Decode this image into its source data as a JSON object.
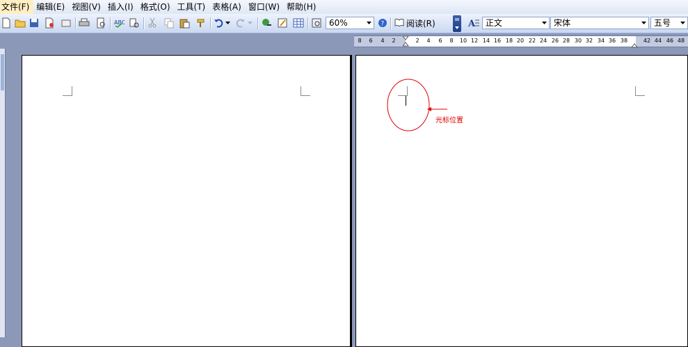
{
  "menu": {
    "items": [
      {
        "label": "文件(F)"
      },
      {
        "label": "编辑(E)"
      },
      {
        "label": "视图(V)"
      },
      {
        "label": "插入(I)"
      },
      {
        "label": "格式(O)"
      },
      {
        "label": "工具(T)"
      },
      {
        "label": "表格(A)"
      },
      {
        "label": "窗口(W)"
      },
      {
        "label": "帮助(H)"
      }
    ]
  },
  "toolbar": {
    "zoom_value": "60%",
    "read_label": "阅读(R)",
    "style_value": "正文",
    "font_value": "宋体",
    "size_value": "五号"
  },
  "ruler": {
    "left_numbers": [
      "8",
      "6",
      "4",
      "2"
    ],
    "right_numbers": [
      "2",
      "4",
      "6",
      "8",
      "10",
      "12",
      "14",
      "16",
      "18",
      "20",
      "22",
      "24",
      "26",
      "28",
      "30",
      "32",
      "34",
      "36",
      "38",
      "42",
      "44",
      "46",
      "48"
    ]
  },
  "annotation": {
    "label": "光标位置",
    "color": "#e00000"
  }
}
